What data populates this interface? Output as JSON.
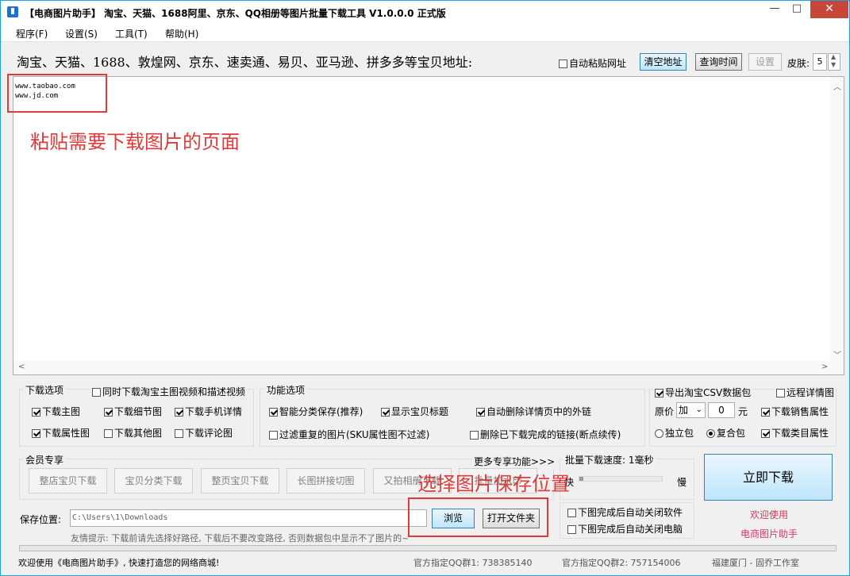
{
  "title": "【电商图片助手】 淘宝、天猫、1688阿里、京东、QQ相册等图片批量下载工具 V1.0.0.0 正式版",
  "window_buttons": {
    "minimize": "—",
    "maximize": "□",
    "close": "✕"
  },
  "menu": [
    "程序(F)",
    "设置(S)",
    "工具(T)",
    "帮助(H)"
  ],
  "urlbar": {
    "label": "淘宝、天猫、1688、敦煌网、京东、速卖通、易贝、亚马逊、拼多多等宝贝地址:",
    "auto_paste": "自动粘贴网址",
    "clear": "清空地址",
    "query_time": "查询时间",
    "settings": "设置",
    "skin_label": "皮肤:",
    "skin_value": "5"
  },
  "urls": [
    "www.taobao.com",
    "www.jd.com"
  ],
  "annotations": {
    "paste_hint": "粘贴需要下载图片的页面",
    "save_hint": "选择图片保存位置"
  },
  "download_options": {
    "title": "下载选项",
    "sync_video": "同时下载淘宝主图视频和描述视频",
    "items": [
      {
        "label": "下载主图",
        "checked": true
      },
      {
        "label": "下载细节图",
        "checked": true
      },
      {
        "label": "下载手机详情",
        "checked": true
      },
      {
        "label": "下载属性图",
        "checked": true
      },
      {
        "label": "下载其他图",
        "checked": false
      },
      {
        "label": "下载评论图",
        "checked": false
      }
    ]
  },
  "function_options": {
    "title": "功能选项",
    "items": [
      {
        "label": "智能分类保存(推荐)",
        "checked": true
      },
      {
        "label": "显示宝贝标题",
        "checked": true
      },
      {
        "label": "自动删除详情页中的外链",
        "checked": true
      },
      {
        "label": "过滤重复的图片(SKU属性图不过滤)",
        "checked": false
      },
      {
        "label": "删除已下载完成的链接(断点续传)",
        "checked": false
      }
    ]
  },
  "export_options": {
    "export_csv": "导出淘宝CSV数据包",
    "remote_detail": "远程详情图",
    "price_label": "原价",
    "price_op": "加",
    "price_value": "0",
    "price_unit": "元",
    "sales_attr": "下载销售属性",
    "standalone": "独立包",
    "composite": "复合包",
    "category_attr": "下载类目属性"
  },
  "member": {
    "title": "会员专享",
    "more": "更多专享功能>>>",
    "buttons": [
      "整店宝贝下载",
      "宝贝分类下载",
      "整页宝贝下载",
      "长图拼接切图",
      "又拍相册下载",
      "批量加水印"
    ]
  },
  "speed": {
    "label": "批量下载速度: 1毫秒",
    "fast": "快",
    "slow": "慢",
    "level": 0.05
  },
  "after_download": {
    "close_app": "下图完成后自动关闭软件",
    "close_pc": "下图完成后自动关闭电脑"
  },
  "download_now": "立即下载",
  "welcome": [
    "欢迎使用",
    "电商图片助手"
  ],
  "save": {
    "label": "保存位置:",
    "path": "C:\\Users\\1\\Downloads",
    "browse": "浏览",
    "open_folder": "打开文件夹",
    "hint": "友情提示: 下载前请先选择好路径, 下载后不要改变路径, 否则数据包中显示不了图片的~"
  },
  "status": {
    "welcome": "欢迎使用《电商图片助手》, 快速打造您的网络商城!",
    "qq1": "官方指定QQ群1: 738385140",
    "qq2": "官方指定QQ群2: 757154006",
    "studio": "福建厦门 - 固乔工作室"
  },
  "colors": {
    "accent_red": "#e03a3a",
    "close_red": "#c7463a",
    "welcome_pink": "#d9355d"
  }
}
